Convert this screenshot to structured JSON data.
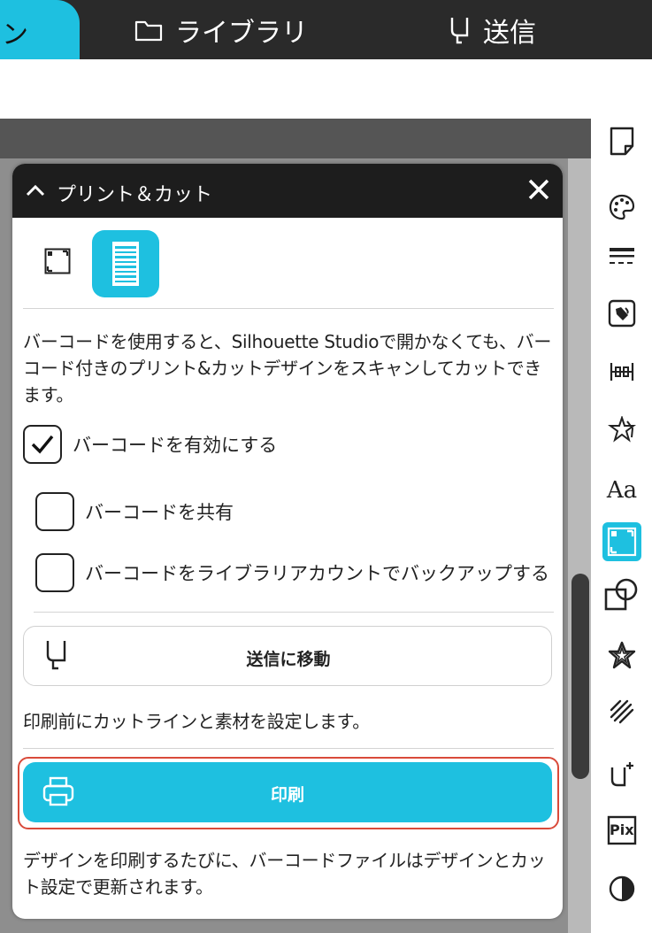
{
  "nav": {
    "active_tab_fragment": "ン",
    "library_label": "ライブラリ",
    "send_label": "送信"
  },
  "panel": {
    "title": "プリント＆カット",
    "description_1": "バーコードを使用すると、Silhouette Studioで開かなくても、バーコード付きのプリント&カットデザインをスキャンしてカットできます。",
    "checkboxes": [
      {
        "label": "バーコードを有効にする",
        "checked": true
      },
      {
        "label": "バーコードを共有",
        "checked": false
      },
      {
        "label": "バーコードをライブラリアカウントでバックアップする",
        "checked": false
      }
    ],
    "send_button_label": "送信に移動",
    "description_2": "印刷前にカットラインと素材を設定します。",
    "print_button_label": "印刷",
    "description_3": "デザインを印刷するたびに、バーコードファイルはデザインとカット設定で更新されます。"
  },
  "rail": {
    "text_icon_label": "Aa",
    "pix_icon_label": "Pix"
  },
  "colors": {
    "accent": "#1ec0e0",
    "highlight_frame": "#d94a3a",
    "header_dark": "#1d1d1d"
  }
}
